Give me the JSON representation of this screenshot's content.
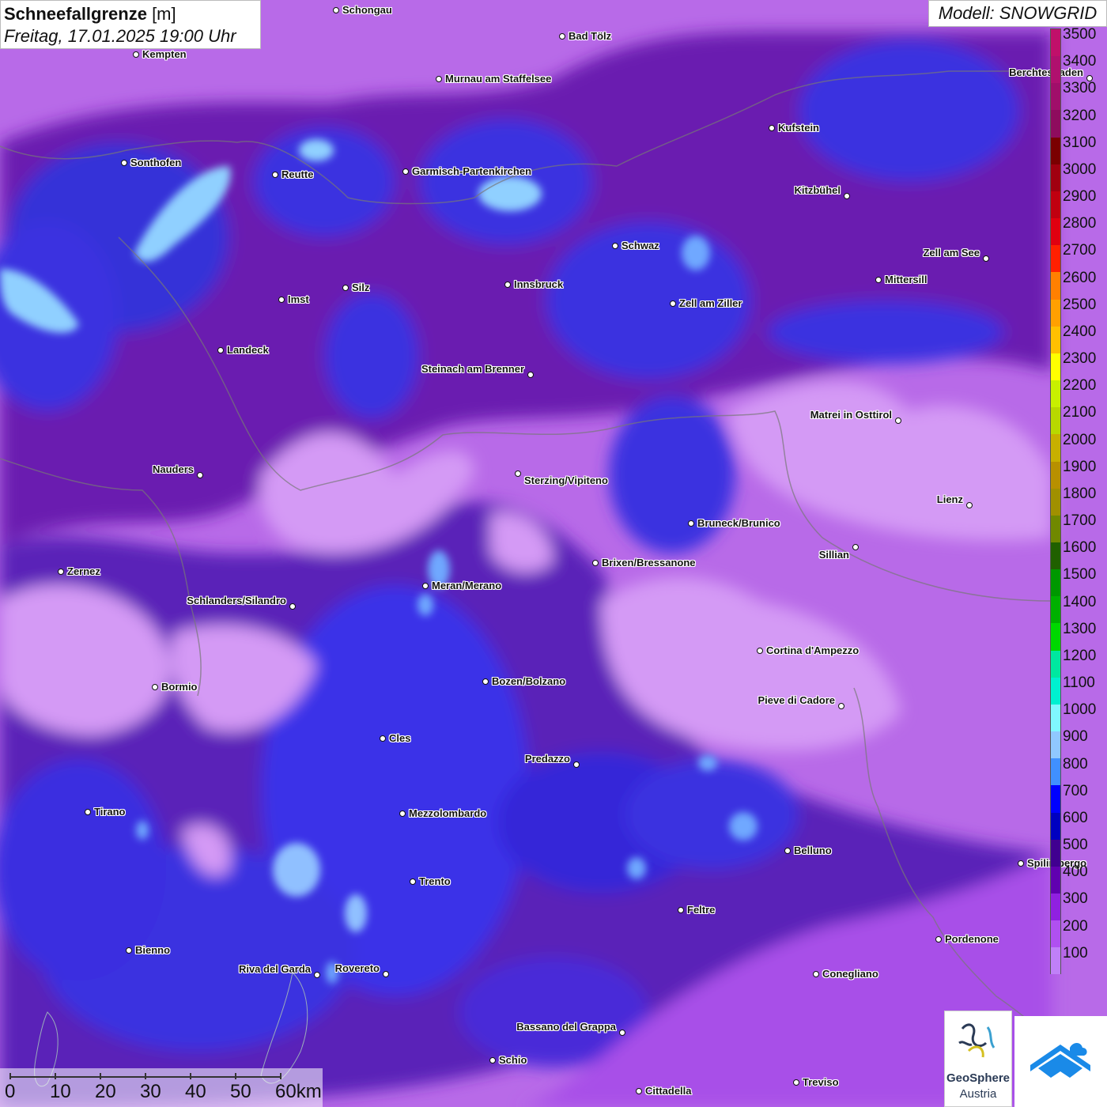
{
  "header": {
    "title_bold": "Schneefallgrenze",
    "title_unit": " [m]",
    "datetime": "Freitag, 17.01.2025 19:00 Uhr",
    "model": "Modell: SNOWGRID"
  },
  "legend": {
    "labels": [
      "3500",
      "3400",
      "3300",
      "3200",
      "3100",
      "3000",
      "2900",
      "2800",
      "2700",
      "2600",
      "2500",
      "2400",
      "2300",
      "2200",
      "2100",
      "2000",
      "1900",
      "1800",
      "1700",
      "1600",
      "1500",
      "1400",
      "1300",
      "1200",
      "1100",
      "1000",
      "900",
      "800",
      "700",
      "600",
      "500",
      "400",
      "300",
      "200",
      "100"
    ],
    "colors": [
      "#c0106a",
      "#b0106e",
      "#a00e6a",
      "#8e0c5e",
      "#7a0000",
      "#a00010",
      "#c00010",
      "#e00010",
      "#ff2000",
      "#ff8000",
      "#ffa000",
      "#ffc000",
      "#ffff00",
      "#c8f000",
      "#b8d800",
      "#c8b000",
      "#b89000",
      "#a09000",
      "#708800",
      "#206000",
      "#009800",
      "#00b000",
      "#00d800",
      "#00e8a0",
      "#00f0d0",
      "#80f8ff",
      "#90c8ff",
      "#4090ff",
      "#0000ff",
      "#0000c0",
      "#400090",
      "#6000b0",
      "#9020e0",
      "#b050f0",
      "#c080f8"
    ]
  },
  "cities": [
    {
      "name": "Schongau"
    },
    {
      "name": "Bad Tölz"
    },
    {
      "name": "Kempten"
    },
    {
      "name": "Murnau am Staffelsee"
    },
    {
      "name": "Berchtesgaden"
    },
    {
      "name": "Kufstein"
    },
    {
      "name": "Sonthofen"
    },
    {
      "name": "Reutte"
    },
    {
      "name": "Garmisch-Partenkirchen"
    },
    {
      "name": "Kitzbühel"
    },
    {
      "name": "Schwaz"
    },
    {
      "name": "Zell am See"
    },
    {
      "name": "Imst"
    },
    {
      "name": "Silz"
    },
    {
      "name": "Innsbruck"
    },
    {
      "name": "Mittersill"
    },
    {
      "name": "Zell am Ziller"
    },
    {
      "name": "Landeck"
    },
    {
      "name": "Steinach am Brenner"
    },
    {
      "name": "Matrei in Osttirol"
    },
    {
      "name": "Nauders"
    },
    {
      "name": "Sterzing/Vipiteno"
    },
    {
      "name": "Lienz"
    },
    {
      "name": "Bruneck/Brunico"
    },
    {
      "name": "Sillian"
    },
    {
      "name": "Zernez"
    },
    {
      "name": "Brixen/Bressanone"
    },
    {
      "name": "Meran/Merano"
    },
    {
      "name": "Schlanders/Silandro"
    },
    {
      "name": "Cortina d'Ampezzo"
    },
    {
      "name": "Bozen/Bolzano"
    },
    {
      "name": "Bormio"
    },
    {
      "name": "Pieve di Cadore"
    },
    {
      "name": "Cles"
    },
    {
      "name": "Predazzo"
    },
    {
      "name": "Tirano"
    },
    {
      "name": "Mezzolombardo"
    },
    {
      "name": "Belluno"
    },
    {
      "name": "Spilimbergo"
    },
    {
      "name": "Trento"
    },
    {
      "name": "Feltre"
    },
    {
      "name": "Pordenone"
    },
    {
      "name": "Bienno"
    },
    {
      "name": "Riva del Garda"
    },
    {
      "name": "Rovereto"
    },
    {
      "name": "Conegliano"
    },
    {
      "name": "Bassano del Grappa"
    },
    {
      "name": "Schio"
    },
    {
      "name": "Treviso"
    },
    {
      "name": "Cittadella"
    }
  ],
  "scale": {
    "labels": [
      "0",
      "10",
      "20",
      "30",
      "40",
      "50",
      "60km"
    ]
  },
  "logo": {
    "line1": "GeoSphere",
    "line2": "Austria"
  }
}
